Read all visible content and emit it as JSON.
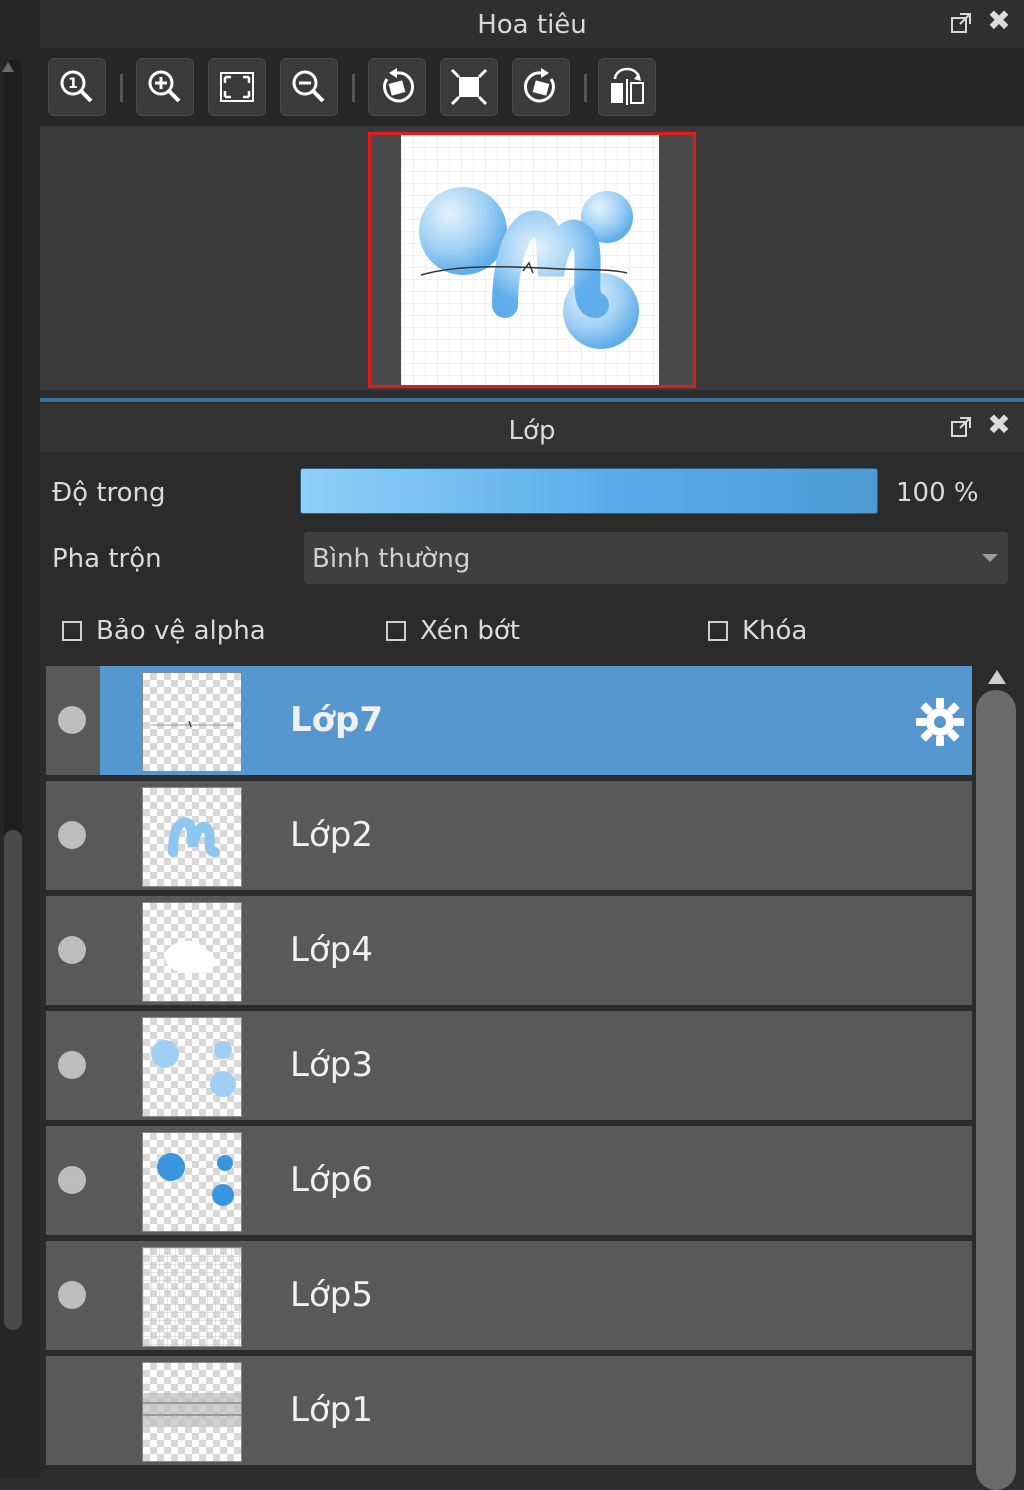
{
  "navigator": {
    "title": "Hoa tiêu",
    "toolbar_icons": [
      "zoom-actual-icon",
      "zoom-in-icon",
      "fit-screen-icon",
      "zoom-out-icon",
      "rotate-left-icon",
      "fit-window-icon",
      "rotate-right-icon",
      "flip-horizontal-icon"
    ]
  },
  "layers_panel": {
    "title": "Lớp",
    "opacity_label": "Độ trong",
    "opacity_value": "100 %",
    "opacity_fraction": 1.0,
    "blend_label": "Pha trộn",
    "blend_value": "Bình thường",
    "checkboxes": [
      {
        "label": "Bảo vệ alpha",
        "checked": false
      },
      {
        "label": "Xén bớt",
        "checked": false
      },
      {
        "label": "Khóa",
        "checked": false
      }
    ],
    "layers": [
      {
        "name": "Lớp7",
        "selected": true,
        "visible": true
      },
      {
        "name": "Lớp2",
        "selected": false,
        "visible": true
      },
      {
        "name": "Lớp4",
        "selected": false,
        "visible": true
      },
      {
        "name": "Lớp3",
        "selected": false,
        "visible": true
      },
      {
        "name": "Lớp6",
        "selected": false,
        "visible": true
      },
      {
        "name": "Lớp5",
        "selected": false,
        "visible": true
      },
      {
        "name": "Lớp1",
        "selected": false,
        "visible": false
      }
    ]
  },
  "colors": {
    "selection": "#5697cf",
    "preview_border": "#e01c1c",
    "opacity_fill": "#5aabea"
  }
}
